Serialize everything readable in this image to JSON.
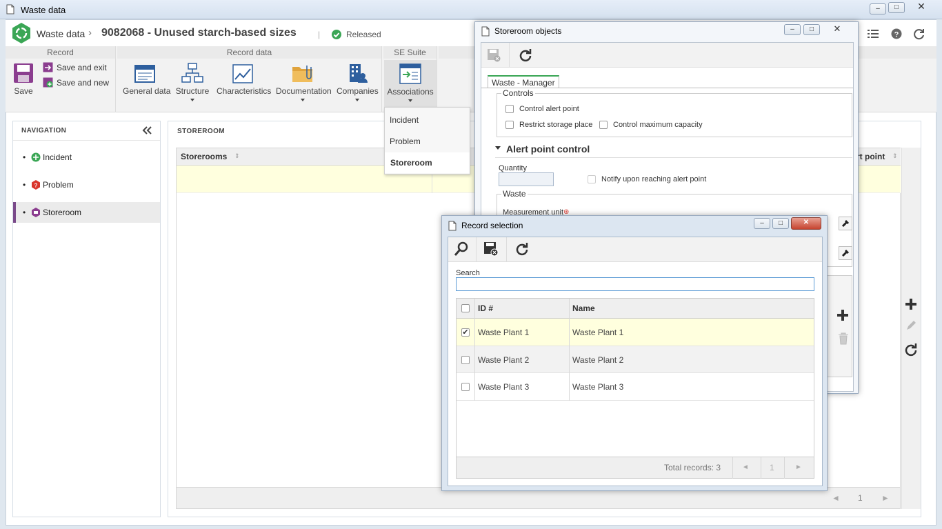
{
  "window": {
    "title": "Waste data"
  },
  "header": {
    "app_name": "Waste data",
    "breadcrumb_sep": "›",
    "record_title": "9082068 - Unused starch-based sizes",
    "pipe": "|",
    "status": "Released"
  },
  "ribbon": {
    "groups": [
      "Record",
      "Record data",
      "SE Suite"
    ],
    "save": "Save",
    "save_exit": "Save and exit",
    "save_new": "Save and new",
    "general_data": "General data",
    "structure": "Structure",
    "characteristics": "Characteristics",
    "documentation": "Documentation",
    "companies": "Companies",
    "associations": "Associations"
  },
  "associations_menu": [
    "Incident",
    "Problem",
    "Storeroom"
  ],
  "navigation": {
    "title": "NAVIGATION",
    "items": [
      "Incident",
      "Problem",
      "Storeroom"
    ]
  },
  "storeroom_panel": {
    "title": "STOREROOM",
    "col_storerooms": "Storerooms",
    "col_partial": "rt point",
    "pager_page": "1"
  },
  "storeroom_dialog": {
    "title": "Storeroom objects",
    "tab": "Waste - Manager",
    "controls_legend": "Controls",
    "control_alert_point": "Control alert point",
    "restrict_storage": "Restrict storage place",
    "control_max_capacity": "Control maximum capacity",
    "alert_section": "Alert point control",
    "quantity_label": "Quantity",
    "notify_label": "Notify upon reaching alert point",
    "waste_legend": "Waste",
    "measurement_unit": "Measurement unit"
  },
  "record_dialog": {
    "title": "Record selection",
    "search_label": "Search",
    "search_value": "",
    "col_id": "ID #",
    "col_name": "Name",
    "rows": [
      {
        "id": "Waste Plant 1",
        "name": "Waste Plant 1",
        "checked": true
      },
      {
        "id": "Waste Plant 2",
        "name": "Waste Plant 2",
        "checked": false
      },
      {
        "id": "Waste Plant 3",
        "name": "Waste Plant 3",
        "checked": false
      }
    ],
    "total_records": "Total records: 3",
    "pager_page": "1"
  },
  "colors": {
    "accent_green": "#3aa655",
    "nav_selected_bar": "#7a4a8a",
    "row_highlight": "#ffffde",
    "focus_border": "#5b9bd5"
  }
}
